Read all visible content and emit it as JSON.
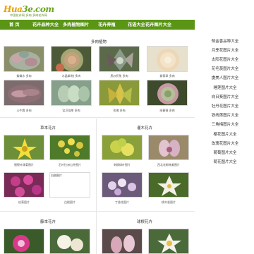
{
  "site": {
    "logo_text_a": "Hua",
    "logo_text_b": "3e.com",
    "logo_sub": "中国花卉网 多肉 多肉花卉网"
  },
  "nav": {
    "items": [
      "首 页",
      "花卉品种大全",
      "多肉植物图片",
      "花卉养殖",
      "花语大全",
      "花卉图片大全"
    ]
  },
  "colors": {
    "nav_bg": "#5a9516",
    "logo_orange": "#e8a000",
    "logo_green": "#6aa51b"
  },
  "succulents": {
    "title": "多肉植物",
    "items": [
      {
        "caption": "紫蝶水 多肉"
      },
      {
        "caption": "水晶掌/桃 多肉"
      },
      {
        "caption": "黑纱折兔 多肉"
      },
      {
        "caption": "紫翡翠 多肉"
      },
      {
        "caption": "斗牛舞 多肉"
      },
      {
        "caption": "宝贝倍厚 多肉"
      },
      {
        "caption": "玫瑰 多肉"
      },
      {
        "caption": "绿蔷薇 多肉"
      }
    ]
  },
  "herbs": {
    "title": "草本花卉",
    "items": [
      {
        "caption": "细裂叶珠菊图片"
      },
      {
        "caption": "石叶拉洲山芥图片"
      },
      {
        "caption": "松菊图片"
      },
      {
        "caption": "白剧图片"
      }
    ],
    "placeholder_top": "白剧图片"
  },
  "shrubs": {
    "title": "灌木花卉",
    "items": [
      {
        "caption": "刺柳绿叶图片"
      },
      {
        "caption": "西北花楸林紫图片"
      },
      {
        "caption": "丁香花图片"
      },
      {
        "caption": "桃木香图片"
      }
    ]
  },
  "vines": {
    "title": "藤本花卉"
  },
  "bulbs": {
    "title": "球根花卉"
  },
  "sidebar": {
    "items": [
      "郁金香品种大全",
      "月季花图片大全",
      "太阳花图片大全",
      "花毛茛图片大全",
      "虞美人图片大全",
      "睡莲图片大全",
      "向日葵图片大全",
      "牡丹花图片大全",
      "铁线莲图片大全",
      "三角梅图片大全",
      "樱花图片大全",
      "玫瑰花图片大全",
      "葡萄图片大全",
      "菊花图片大全"
    ]
  }
}
